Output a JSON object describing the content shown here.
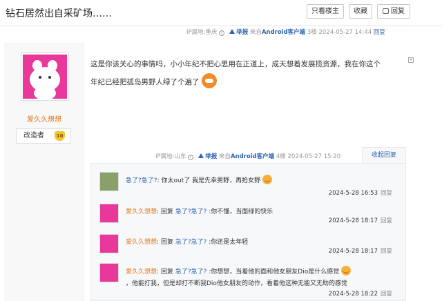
{
  "header": {
    "title": "钻石居然出自采矿场……",
    "buttons": {
      "only_author": "只看楼主",
      "favorite": "收藏",
      "reply": "回复"
    }
  },
  "prev_floor": {
    "ip": "IP属地:重庆",
    "report": "举报",
    "source_prefix": "来自",
    "client": "Android客户端",
    "floor": "3楼",
    "time": "2024-05-27 14:44",
    "reply": "回复"
  },
  "user": {
    "name": "爱久久想想",
    "badge_label": "改造者",
    "badge_level": "10"
  },
  "post": {
    "line1": "这是你该关心的事情吗，小小年纪不把心思用在正道上，成天想着发展揽资源，我在你这个",
    "line2": "年纪已经把孤岛男野人绿了个遍了"
  },
  "floor_meta": {
    "ip": "IP属地:山东",
    "report": "举报",
    "source_prefix": "来自",
    "client": "Android客户端",
    "floor": "4楼",
    "time": "2024-05-27 15:20",
    "collapse": "收起回复"
  },
  "replies": [
    {
      "author": "急了?急了?",
      "sep": ":",
      "text": "你太out了 我是先幸男野，再抢女野",
      "time": "2024-5-28 16:53",
      "reply": "回复"
    },
    {
      "author": "爱久久想想",
      "sep": ":",
      "prefix": "回复",
      "target": "急了?急了?",
      "text": ":你不懂，当面绿的快乐",
      "time": "2024-5-28 18:17",
      "reply": "回复"
    },
    {
      "author": "爱久久想想",
      "sep": ":",
      "prefix": "回复",
      "target": "急了?急了?",
      "text": ":你还是太年轻",
      "time": "2024-5-28 18:17",
      "reply": "回复"
    },
    {
      "author": "爱久久想想",
      "sep": ":",
      "prefix": "回复",
      "target": "急了?急了?",
      "text": ":你想想，当着他的面和他女朋友Dio是什么感觉",
      "text2": "，他能打我，但是却打不断我Dio他女朋友的动作，看着他这种无能又无助的感觉",
      "time": "2024-5-28 18:22",
      "reply": "回复"
    }
  ],
  "icons": {
    "report": "warning-icon",
    "help": "question-circle-icon",
    "reply_btn": "comment-icon",
    "emoji_angry": "angry-face-icon",
    "emoji_smile": "smile-face-icon"
  }
}
